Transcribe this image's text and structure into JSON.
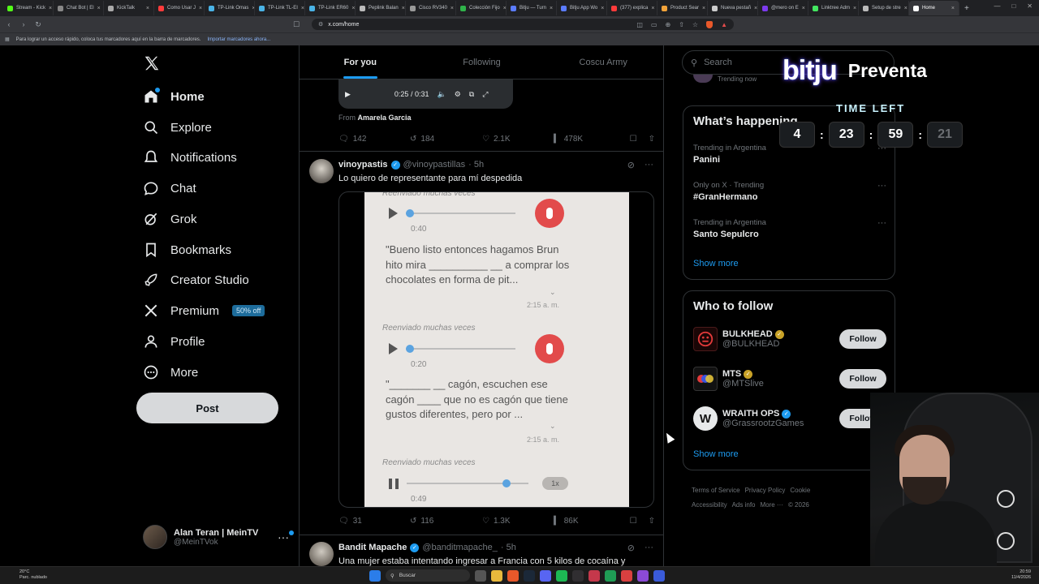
{
  "browser": {
    "tabs": [
      {
        "label": "Stream - Kick",
        "color": "#53fc18"
      },
      {
        "label": "Chat Bot | El",
        "color": "#888888"
      },
      {
        "label": "KickTalk",
        "color": "#aaaaaa"
      },
      {
        "label": "Como Usar J",
        "color": "#ff3b3b"
      },
      {
        "label": "TP-Link Omas",
        "color": "#4ab3e6"
      },
      {
        "label": "TP-Link TL-EI",
        "color": "#4ab3e6"
      },
      {
        "label": "TP-Link ER60",
        "color": "#4ab3e6"
      },
      {
        "label": "Peplink Balan",
        "color": "#bbbbbb"
      },
      {
        "label": "Cisco RV340",
        "color": "#999999"
      },
      {
        "label": "Colección Fijo",
        "color": "#2fb34a"
      },
      {
        "label": "Bitju — Turn",
        "color": "#5b7cff"
      },
      {
        "label": "Bitju App Wo",
        "color": "#5b7cff"
      },
      {
        "label": "(377) explica",
        "color": "#ff3b3b"
      },
      {
        "label": "Product Sear",
        "color": "#f2a33a"
      },
      {
        "label": "Nueva pestañ",
        "color": "#cccccc"
      },
      {
        "label": "@mero on E",
        "color": "#7c3aed"
      },
      {
        "label": "Linktree Adm",
        "color": "#43e660"
      },
      {
        "label": "Setup de stre",
        "color": "#bbbbbb"
      },
      {
        "label": "Home",
        "color": "#ffffff",
        "active": true
      }
    ],
    "url": "x.com/home",
    "bookmarks_hint": "Para lograr un acceso rápido, coloca tus marcadores aquí en la barra de marcadores.",
    "bookmarks_import": "Importar marcadores ahora..."
  },
  "nav": {
    "items": [
      {
        "label": "Home",
        "icon": "home-icon"
      },
      {
        "label": "Explore",
        "icon": "search-icon"
      },
      {
        "label": "Notifications",
        "icon": "bell-icon"
      },
      {
        "label": "Chat",
        "icon": "chat-icon"
      },
      {
        "label": "Grok",
        "icon": "grok-icon"
      },
      {
        "label": "Bookmarks",
        "icon": "bookmark-icon"
      },
      {
        "label": "Creator Studio",
        "icon": "rocket-icon"
      },
      {
        "label": "Premium",
        "icon": "x-icon",
        "badge": "50% off"
      },
      {
        "label": "Profile",
        "icon": "person-icon"
      },
      {
        "label": "More",
        "icon": "more-circle-icon"
      }
    ],
    "post_label": "Post",
    "account": {
      "name": "Alan Teran | MeinTV",
      "handle": "@MeinTVok"
    }
  },
  "feed": {
    "tabs": [
      "For you",
      "Following",
      "Coscu Army"
    ],
    "prev": {
      "video_time": "0:25 / 0:31",
      "from_label": "From",
      "from_name": "Amarela Garcia",
      "replies": "142",
      "reposts": "184",
      "likes": "2.1K",
      "views": "478K"
    },
    "tweet1": {
      "name": "vinoypastis",
      "handle": "@vinoypastillas",
      "time": "· 5h",
      "text": "Lo quiero de representante para mí despedida",
      "media": {
        "fwd": "Reenviado muchas veces",
        "a1_time": "0:40",
        "a1_quote": "\"Bueno listo entonces hagamos Brun hito mira __________ __ a comprar los chocolates en forma de pit...",
        "a1_stamp": "2:15 a. m.",
        "a2_time": "0:20",
        "a2_quote": "\"_______ __ cagón, escuchen ese cagón ____ que no es cagón que tiene gustos diferentes, pero por ...",
        "a2_stamp": "2:15 a. m.",
        "a3_time": "0:49",
        "a3_speed": "1x"
      },
      "replies": "31",
      "reposts": "116",
      "likes": "1.3K",
      "views": "86K"
    },
    "tweet2": {
      "name": "Bandit Mapache",
      "handle": "@banditmapache_",
      "time": "· 5h",
      "text": "Una mujer estaba intentando ingresar a Francia con 5 kilos de cocaína y"
    }
  },
  "right": {
    "search_placeholder": "Search",
    "trending_peek": "Trending now",
    "happening": {
      "title": "What’s happening",
      "items": [
        {
          "meta": "Trending in Argentina",
          "name": "Panini"
        },
        {
          "meta": "Only on X · Trending",
          "name": "#GranHermano"
        },
        {
          "meta": "Trending in Argentina",
          "name": "Santo Sepulcro"
        }
      ],
      "show_more": "Show more"
    },
    "who_to_follow": {
      "title": "Who to follow",
      "items": [
        {
          "name": "BULKHEAD",
          "handle": "@BULKHEAD",
          "badge": "gold"
        },
        {
          "name": "MTS",
          "handle": "@MTSlive",
          "badge": "gold"
        },
        {
          "name": "WRAITH OPS",
          "handle": "@GrassrootzGames",
          "badge": "blue"
        }
      ],
      "follow_label": "Follow",
      "show_more": "Show more"
    },
    "footer": [
      "Terms of Service",
      "Privacy Policy",
      "Cookie",
      "Accessibility",
      "Ads info",
      "More ···",
      "© 2026"
    ]
  },
  "overlay": {
    "brand": "bitju",
    "preventa": "Preventa",
    "time_left": "TIME LEFT",
    "countdown": [
      "4",
      "23",
      "59",
      "21"
    ]
  },
  "taskbar": {
    "weather_temp": "20°C",
    "weather_desc": "Parc. nublado",
    "search": "Buscar",
    "time": "20:59",
    "date": "11/4/2026"
  }
}
